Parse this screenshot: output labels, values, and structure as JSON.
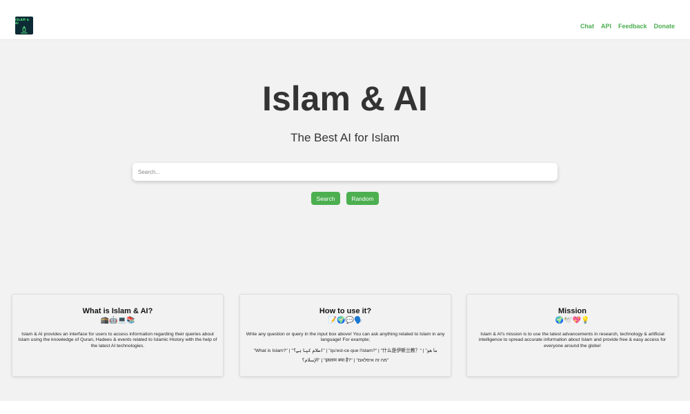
{
  "header": {
    "logo_text": "ISLAM & AI",
    "nav": [
      "Chat",
      "API",
      "Feedback",
      "Donate"
    ]
  },
  "hero": {
    "title": "Islam & AI",
    "subtitle": "The Best AI for Islam"
  },
  "search": {
    "placeholder": "Search...",
    "value": "",
    "search_label": "Search",
    "random_label": "Random"
  },
  "cards": [
    {
      "title": "What is Islam & AI?",
      "emojis": "🕋🤖💻📚",
      "text": "Islam & AI provides an interface for users to access information regarding their queries about Islam using the knowledge of Quran, Hadees & events related to Islamic History with the help of the latest AI technologies."
    },
    {
      "title": "How to use it?",
      "emojis": "📝🌍💬🗣️",
      "text": "Write any question or query in the input box above! You can ask anything related to Islam in any language! For example;",
      "examples": "\"What is Islam?\" | \"اسلام کیا ہے؟\" | \"qu'est-ce que l'islam?\" | \"什么是伊斯兰教？\" | \"ما هو الإسلام؟\" | \"इस्लाम क्या है?\" | \"מה זה איסלאם\""
    },
    {
      "title": "Mission",
      "emojis": "🌍🕊️💖💡",
      "text": "Islam & AI's mission is to use the latest advancements in research, technology & artificial intelligence to spread accurate information about Islam and provide free & easy access for everyone around the globe!"
    }
  ],
  "colors": {
    "accent": "#4caf50",
    "background": "#f2f2f2",
    "text": "#333333"
  }
}
